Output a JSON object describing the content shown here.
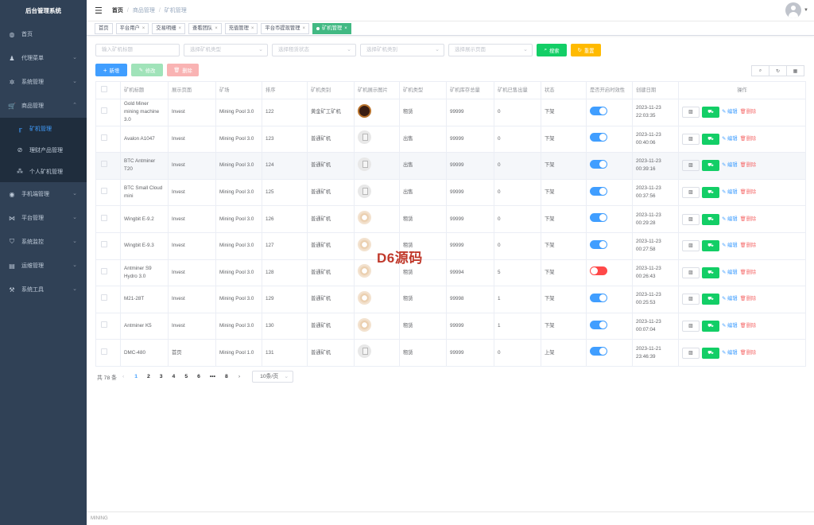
{
  "sidebar": {
    "title": "后台管理系统",
    "items": [
      {
        "label": "首页",
        "icon": "dashboard-icon"
      },
      {
        "label": "代理菜单",
        "icon": "user-icon",
        "arrow": true
      },
      {
        "label": "系统管理",
        "icon": "gear-icon",
        "arrow": true
      },
      {
        "label": "商品管理",
        "icon": "cart-icon",
        "arrow": true,
        "expanded": true
      }
    ],
    "sub_items": [
      {
        "label": "矿机管理",
        "icon": "miner-icon",
        "active": true
      },
      {
        "label": "理财产品管理",
        "icon": "finance-icon"
      },
      {
        "label": "个人矿机管理",
        "icon": "tree-icon"
      }
    ],
    "items_after": [
      {
        "label": "手机端管理",
        "icon": "phone-icon",
        "arrow": true
      },
      {
        "label": "平台管理",
        "icon": "platform-icon",
        "arrow": true
      },
      {
        "label": "系统监控",
        "icon": "monitor-icon",
        "arrow": true
      },
      {
        "label": "运维管理",
        "icon": "server-icon",
        "arrow": true
      },
      {
        "label": "系统工具",
        "icon": "tool-icon",
        "arrow": true
      }
    ]
  },
  "breadcrumb": [
    "首页",
    "商品管理",
    "矿机管理"
  ],
  "tabs": [
    {
      "label": "首页",
      "closable": false
    },
    {
      "label": "平台用户",
      "closable": true
    },
    {
      "label": "交易明细",
      "closable": true
    },
    {
      "label": "查看团队",
      "closable": true
    },
    {
      "label": "充值管理",
      "closable": true
    },
    {
      "label": "平台币提现管理",
      "closable": true
    },
    {
      "label": "矿机管理",
      "closable": true,
      "active": true
    }
  ],
  "filters": {
    "title_placeholder": "输入矿机标题",
    "type_placeholder": "选择矿机类型",
    "rent_placeholder": "选择租赁状态",
    "category_placeholder": "选择矿机类别",
    "page_placeholder": "选择展示页面",
    "search_label": "搜索",
    "reset_label": "重置"
  },
  "toolbar": {
    "add_label": "新增",
    "edit_label": "修改",
    "delete_label": "删除"
  },
  "table": {
    "columns": [
      "矿机标题",
      "展示页面",
      "矿场",
      "排序",
      "矿机类别",
      "矿机展示图片",
      "矿机类型",
      "矿机库存总量",
      "矿机已售出量",
      "状态",
      "是否开启时效性",
      "创建日期",
      "操作"
    ],
    "rows": [
      {
        "title": "Gold Miner mining machine 3.0",
        "page": "Invest",
        "farm": "Mining Pool 3.0",
        "sort": "122",
        "category": "黄金矿工矿机",
        "image": "dark",
        "type": "租赁",
        "stock": "99999",
        "sold": "0",
        "status": "下架",
        "switch": "on",
        "date": "2023-11-23 22:03:35"
      },
      {
        "title": "Avalon A1047",
        "page": "Invest",
        "farm": "Mining Pool 3.0",
        "sort": "123",
        "category": "普通矿机",
        "image": "doc",
        "type": "出售",
        "stock": "99999",
        "sold": "0",
        "status": "下架",
        "switch": "on",
        "date": "2023-11-23 00:40:06"
      },
      {
        "title": "BTC Antminer T20",
        "page": "Invest",
        "farm": "Mining Pool 3.0",
        "sort": "124",
        "category": "普通矿机",
        "image": "doc",
        "type": "出售",
        "stock": "99999",
        "sold": "0",
        "status": "下架",
        "switch": "on",
        "date": "2023-11-23 00:39:16"
      },
      {
        "title": "BTC Small Cloud mini",
        "page": "Invest",
        "farm": "Mining Pool 3.0",
        "sort": "125",
        "category": "普通矿机",
        "image": "doc",
        "type": "出售",
        "stock": "99999",
        "sold": "0",
        "status": "下架",
        "switch": "on",
        "date": "2023-11-23 00:37:56"
      },
      {
        "title": "Wingbit E-9.2",
        "page": "Invest",
        "farm": "Mining Pool 3.0",
        "sort": "126",
        "category": "普通矿机",
        "image": "coin",
        "type": "租赁",
        "stock": "99999",
        "sold": "0",
        "status": "下架",
        "switch": "on",
        "date": "2023-11-23 00:29:28"
      },
      {
        "title": "Wingbit E-9.3",
        "page": "Invest",
        "farm": "Mining Pool 3.0",
        "sort": "127",
        "category": "普通矿机",
        "image": "coin",
        "type": "租赁",
        "stock": "99999",
        "sold": "0",
        "status": "下架",
        "switch": "on",
        "date": "2023-11-23 00:27:58"
      },
      {
        "title": "Antminer S9 Hydro 3.0",
        "page": "Invest",
        "farm": "Mining Pool 3.0",
        "sort": "128",
        "category": "普通矿机",
        "image": "coin",
        "type": "租赁",
        "stock": "99994",
        "sold": "5",
        "status": "下架",
        "switch": "off",
        "date": "2023-11-23 00:26:43"
      },
      {
        "title": "M21-28T",
        "page": "Invest",
        "farm": "Mining Pool 3.0",
        "sort": "129",
        "category": "普通矿机",
        "image": "coin",
        "type": "租赁",
        "stock": "99998",
        "sold": "1",
        "status": "下架",
        "switch": "on",
        "date": "2023-11-23 00:25:53"
      },
      {
        "title": "Antminer K5",
        "page": "Invest",
        "farm": "Mining Pool 3.0",
        "sort": "130",
        "category": "普通矿机",
        "image": "coin",
        "type": "租赁",
        "stock": "99999",
        "sold": "1",
        "status": "下架",
        "switch": "on",
        "date": "2023-11-23 00:07:04"
      },
      {
        "title": "DMC-480",
        "page": "首页",
        "farm": "Mining Pool 1.0",
        "sort": "131",
        "category": "普通矿机",
        "image": "doc",
        "type": "租赁",
        "stock": "99999",
        "sold": "0",
        "status": "上架",
        "switch": "on",
        "date": "2023-11-21 23:46:39"
      }
    ],
    "row_actions": {
      "edit": "编辑",
      "delete": "删除"
    }
  },
  "pagination": {
    "total": "共 78 条",
    "pages": [
      "1",
      "2",
      "3",
      "4",
      "5",
      "6",
      "•••",
      "8"
    ],
    "current": "1",
    "page_size": "10条/页"
  },
  "watermark": "D6源码",
  "footer": "MINING",
  "colors": {
    "sidebar_bg": "#304156",
    "primary": "#409eff",
    "success": "#13ce66",
    "tag_active": "#42b983",
    "warning": "#ffba00",
    "danger": "#ff4949"
  }
}
